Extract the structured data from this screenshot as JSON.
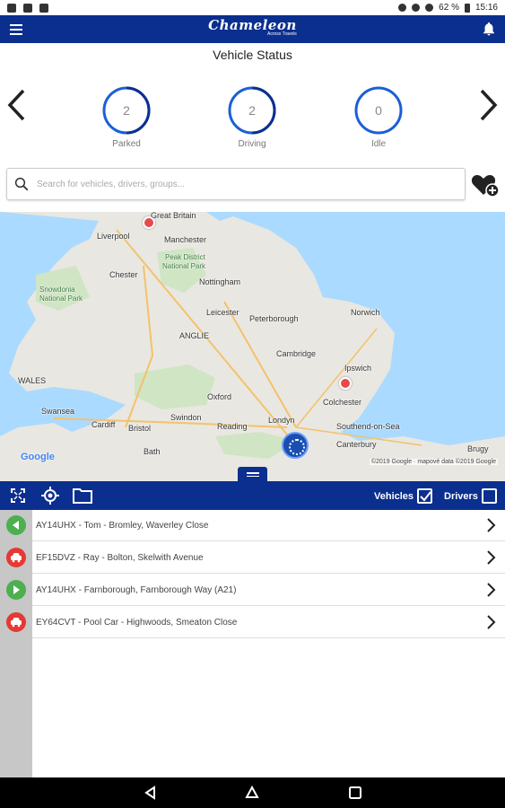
{
  "statusbar": {
    "battery": "62 %",
    "time": "15:16"
  },
  "app": {
    "brand": "Chameleon",
    "brand_sub": "Across Travels"
  },
  "page": {
    "title": "Vehicle Status"
  },
  "stats": [
    {
      "value": "2",
      "label": "Parked",
      "fraction": 0.5
    },
    {
      "value": "2",
      "label": "Driving",
      "fraction": 0.5
    },
    {
      "value": "0",
      "label": "Idle",
      "fraction": 0
    }
  ],
  "search": {
    "placeholder": "Search for vehicles, drivers, groups..."
  },
  "map": {
    "places": {
      "liverpool": "Liverpool",
      "manchester": "Manchester",
      "great_britain": "Great Britain",
      "chester": "Chester",
      "peak_district": "Peak District",
      "national_park": "National Park",
      "snowdonia": "Snowdonia",
      "snowdonia_np": "National Park",
      "nottingham": "Nottingham",
      "leicester": "Leicester",
      "peterborough": "Peterborough",
      "norwich": "Norwich",
      "anglie": "ANGLIE",
      "cambridge": "Cambridge",
      "ipswich": "Ipswich",
      "wales": "WALES",
      "oxford": "Oxford",
      "colchester": "Colchester",
      "swansea": "Swansea",
      "swindon": "Swindon",
      "london": "Londyn",
      "southend": "Southend-on-Sea",
      "cardiff": "Cardiff",
      "bristol": "Bristol",
      "reading": "Reading",
      "bath": "Bath",
      "canterbury": "Canterbury",
      "brugy": "Brugy"
    },
    "google": "Google",
    "attribution": "©2019 Google · mapové data ©2019 Google"
  },
  "toolbar": {
    "vehicles_label": "Vehicles",
    "drivers_label": "Drivers",
    "vehicles_checked": true,
    "drivers_checked": false
  },
  "vehicles": [
    {
      "text": "AY14UHX - Tom - Bromley, Waverley Close",
      "status": "idle",
      "color": "#4caf50"
    },
    {
      "text": "EF15DVZ - Ray - Bolton, Skelwith Avenue",
      "status": "parked",
      "color": "#e53935"
    },
    {
      "text": "AY14UHX - Farnborough, Farnborough Way (A21)",
      "status": "driving",
      "color": "#4caf50"
    },
    {
      "text": "EY64CVT - Pool Car - Highwoods, Smeaton Close",
      "status": "parked",
      "color": "#e53935"
    }
  ],
  "colors": {
    "primary": "#0b2f8f",
    "ring": "#1a5fd6",
    "ring_bg": "#c9d7f5"
  }
}
